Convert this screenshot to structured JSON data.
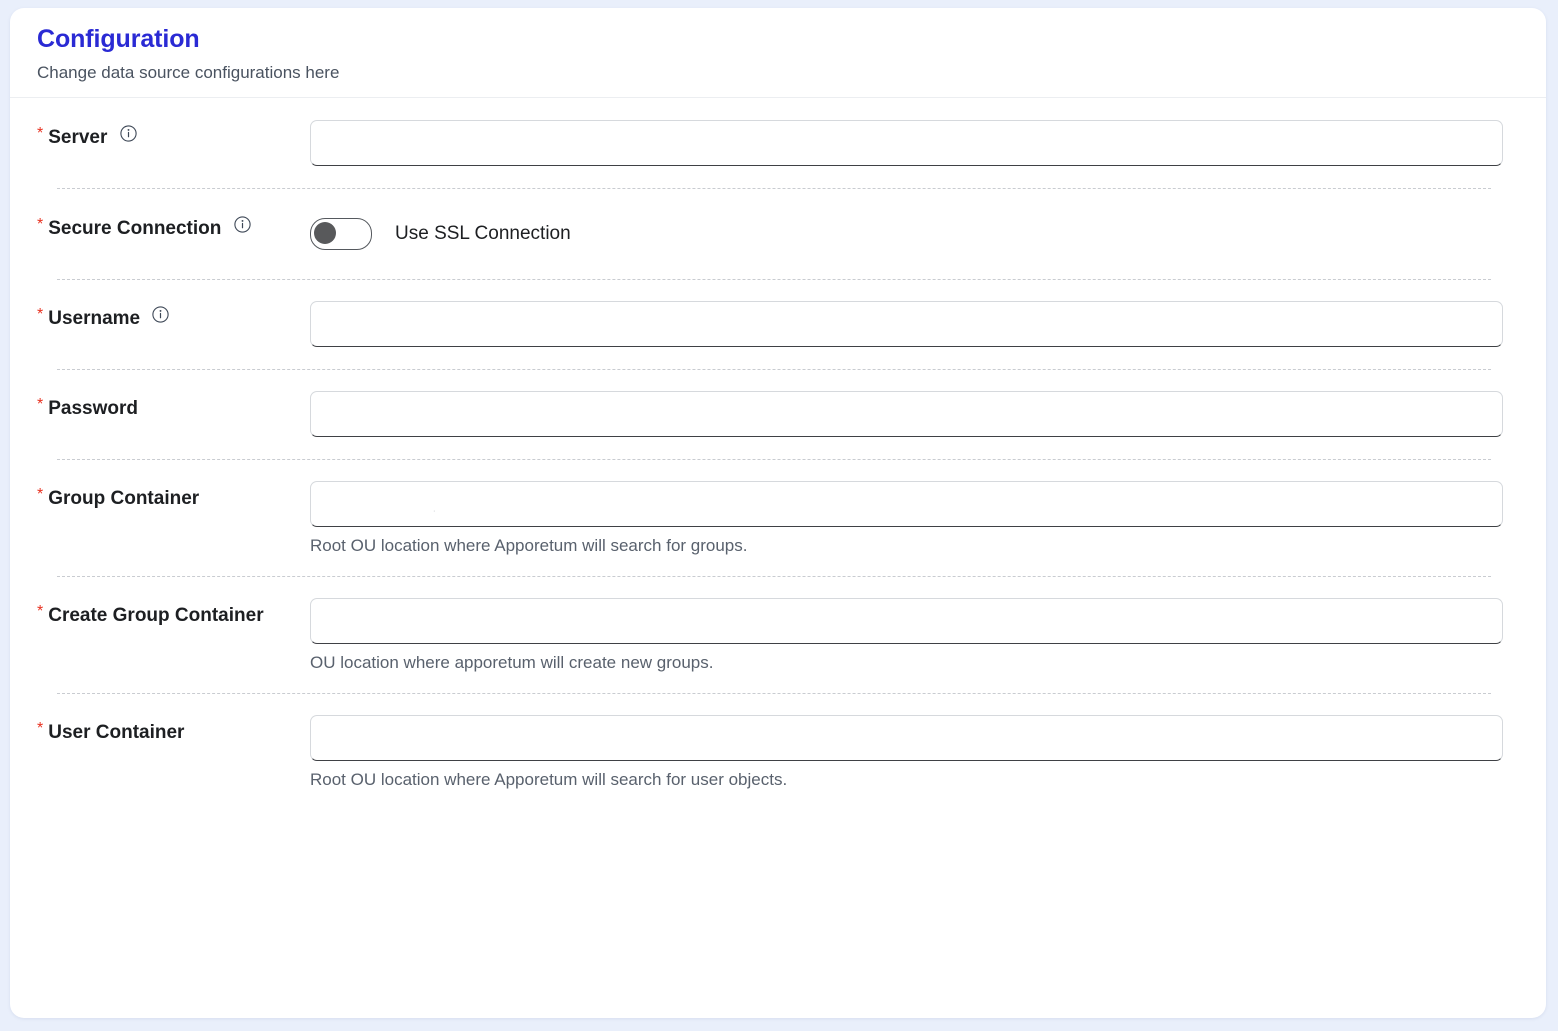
{
  "card": {
    "title": "Configuration",
    "subtitle": "Change data source configurations here"
  },
  "colors": {
    "title_blue": "#2a2ad4",
    "required_red": "#e8301f",
    "page_background": "#e9effb",
    "card_background": "#ffffff",
    "hint_text": "#59616d",
    "toggle_knob": "#58595b"
  },
  "required_marker": "*",
  "fields": [
    {
      "key": "server",
      "label": "Server",
      "required": true,
      "info_icon": "info-circle-icon",
      "type": "text",
      "value": "",
      "placeholder": "",
      "hint": ""
    },
    {
      "key": "secure_connection",
      "label": "Secure Connection",
      "required": true,
      "info_icon": "info-circle-icon",
      "type": "toggle",
      "toggle_label": "Use SSL Connection",
      "toggle_on": false,
      "hint": ""
    },
    {
      "key": "username",
      "label": "Username",
      "required": true,
      "info_icon": "info-circle-icon",
      "type": "text",
      "value": "",
      "placeholder": "",
      "hint": ""
    },
    {
      "key": "password",
      "label": "Password",
      "required": true,
      "info_icon": "",
      "type": "password",
      "value": "",
      "placeholder": "",
      "hint": ""
    },
    {
      "key": "group_container",
      "label": "Group Container",
      "required": true,
      "info_icon": "",
      "type": "text",
      "value": "",
      "placeholder": "",
      "hint": "Root OU location where Apporetum will search for groups."
    },
    {
      "key": "create_group_container",
      "label": "Create Group Container",
      "required": true,
      "info_icon": "",
      "type": "text",
      "value": "",
      "placeholder": "",
      "hint": "OU location where apporetum will create new groups."
    },
    {
      "key": "user_container",
      "label": "User Container",
      "required": true,
      "info_icon": "",
      "type": "text",
      "value": "",
      "placeholder": "",
      "hint": "Root OU location where Apporetum will search for user objects."
    }
  ]
}
